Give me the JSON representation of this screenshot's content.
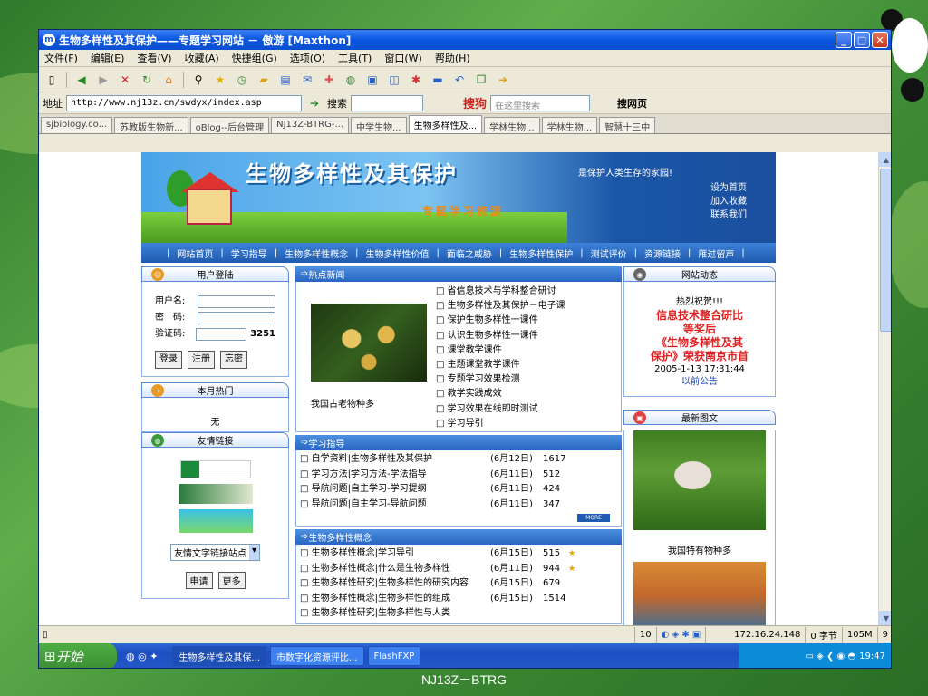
{
  "window": {
    "title": "生物多样性及其保护——专题学习网站 － 傲游 [Maxthon]"
  },
  "menu": [
    "文件(F)",
    "编辑(E)",
    "查看(V)",
    "收藏(A)",
    "快捷组(G)",
    "选项(O)",
    "工具(T)",
    "窗口(W)",
    "帮助(H)"
  ],
  "address": {
    "label": "地址",
    "url": "http://www.nj13z.cn/swdyx/index.asp",
    "search_label": "搜索",
    "sogou_label": "搜狗",
    "sogou_placeholder": "在这里搜索",
    "sogou_btn": "搜网页"
  },
  "tabs": [
    "sjbiology.co...",
    "苏教版生物新...",
    "oBlog--后台管理",
    "NJ13Z-BTRG-...",
    "中学生物...",
    "生物多样性及...",
    "学林生物...",
    "学林生物...",
    "智慧十三中"
  ],
  "banner": {
    "title": "生物多样性及其保护",
    "subtitle": "专题学习资源",
    "slogan": "是保护人类生存的家园!",
    "links": [
      "设为首页",
      "加入收藏",
      "联系我们"
    ]
  },
  "nav": [
    "网站首页",
    "学习指导",
    "生物多样性概念",
    "生物多样性价值",
    "面临之威胁",
    "生物多样性保护",
    "测试评价",
    "资源链接",
    "雁过留声"
  ],
  "login": {
    "header": "用户登陆",
    "user": "用户名:",
    "pass": "密　码:",
    "code": "验证码:",
    "code_value": "3251",
    "btn_login": "登录",
    "btn_reg": "注册",
    "btn_forgot": "忘密"
  },
  "hot": {
    "header": "本月热门",
    "value": "无"
  },
  "friends": {
    "header": "友情链接",
    "select": "友情文字链接站点",
    "apply": "申请",
    "more": "更多"
  },
  "news": {
    "header": "热点新闻",
    "caption": "我国古老物种多",
    "items": [
      "省信息技术与学科整合研讨",
      "生物多样性及其保护－电子课",
      "保护生物多样性一课件",
      "认识生物多样性一课件",
      "课堂教学课件",
      "主题课堂教学课件",
      "专题学习效果检测",
      "教学实践成效",
      "学习效果在线即时测试",
      "学习导引"
    ]
  },
  "study": {
    "header": "学习指导",
    "more": "MORE",
    "rows": [
      {
        "t": "自学资料|生物多样性及其保护",
        "d": "(6月12日)",
        "n": "1617"
      },
      {
        "t": "学习方法|学习方法-学法指导",
        "d": "(6月11日)",
        "n": "512"
      },
      {
        "t": "导航问题|自主学习-学习提纲",
        "d": "(6月11日)",
        "n": "424"
      },
      {
        "t": "导航问题|自主学习-导航问题",
        "d": "(6月11日)",
        "n": "347"
      }
    ]
  },
  "concept": {
    "header": "生物多样性概念",
    "rows": [
      {
        "t": "生物多样性概念|学习导引",
        "d": "(6月15日)",
        "n": "515"
      },
      {
        "t": "生物多样性概念|什么是生物多样性",
        "d": "(6月11日)",
        "n": "944"
      },
      {
        "t": "生物多样性研究|生物多样性的研究内容",
        "d": "(6月15日)",
        "n": "679"
      },
      {
        "t": "生物多样性概念|生物多样性的组成",
        "d": "(6月15日)",
        "n": "1514"
      },
      {
        "t": "生物多样性研究|生物多样性与人类",
        "d": "",
        "n": ""
      }
    ]
  },
  "dynamic": {
    "header": "网站动态",
    "hot": "热烈祝贺!!!",
    "line1": "信息技术整合研比",
    "line2": "等奖后",
    "line3": "《生物多样性及其",
    "line4": "保护》荣获南京市首",
    "date": "2005-1-13 17:31:44",
    "notice": "以前公告"
  },
  "latest": {
    "header": "最新图文",
    "caption": "我国特有物种多"
  },
  "status": {
    "count": "10",
    "ip": "172.16.24.148",
    "bytes": "0 字节",
    "mem": "105M",
    "n": "9"
  },
  "taskbar": {
    "start": "开始",
    "tasks": [
      "生物多样性及其保...",
      "市数字化资源评比...",
      "FlashFXP"
    ],
    "time": "19:47"
  },
  "footer": "NJ13Z－BTRG"
}
